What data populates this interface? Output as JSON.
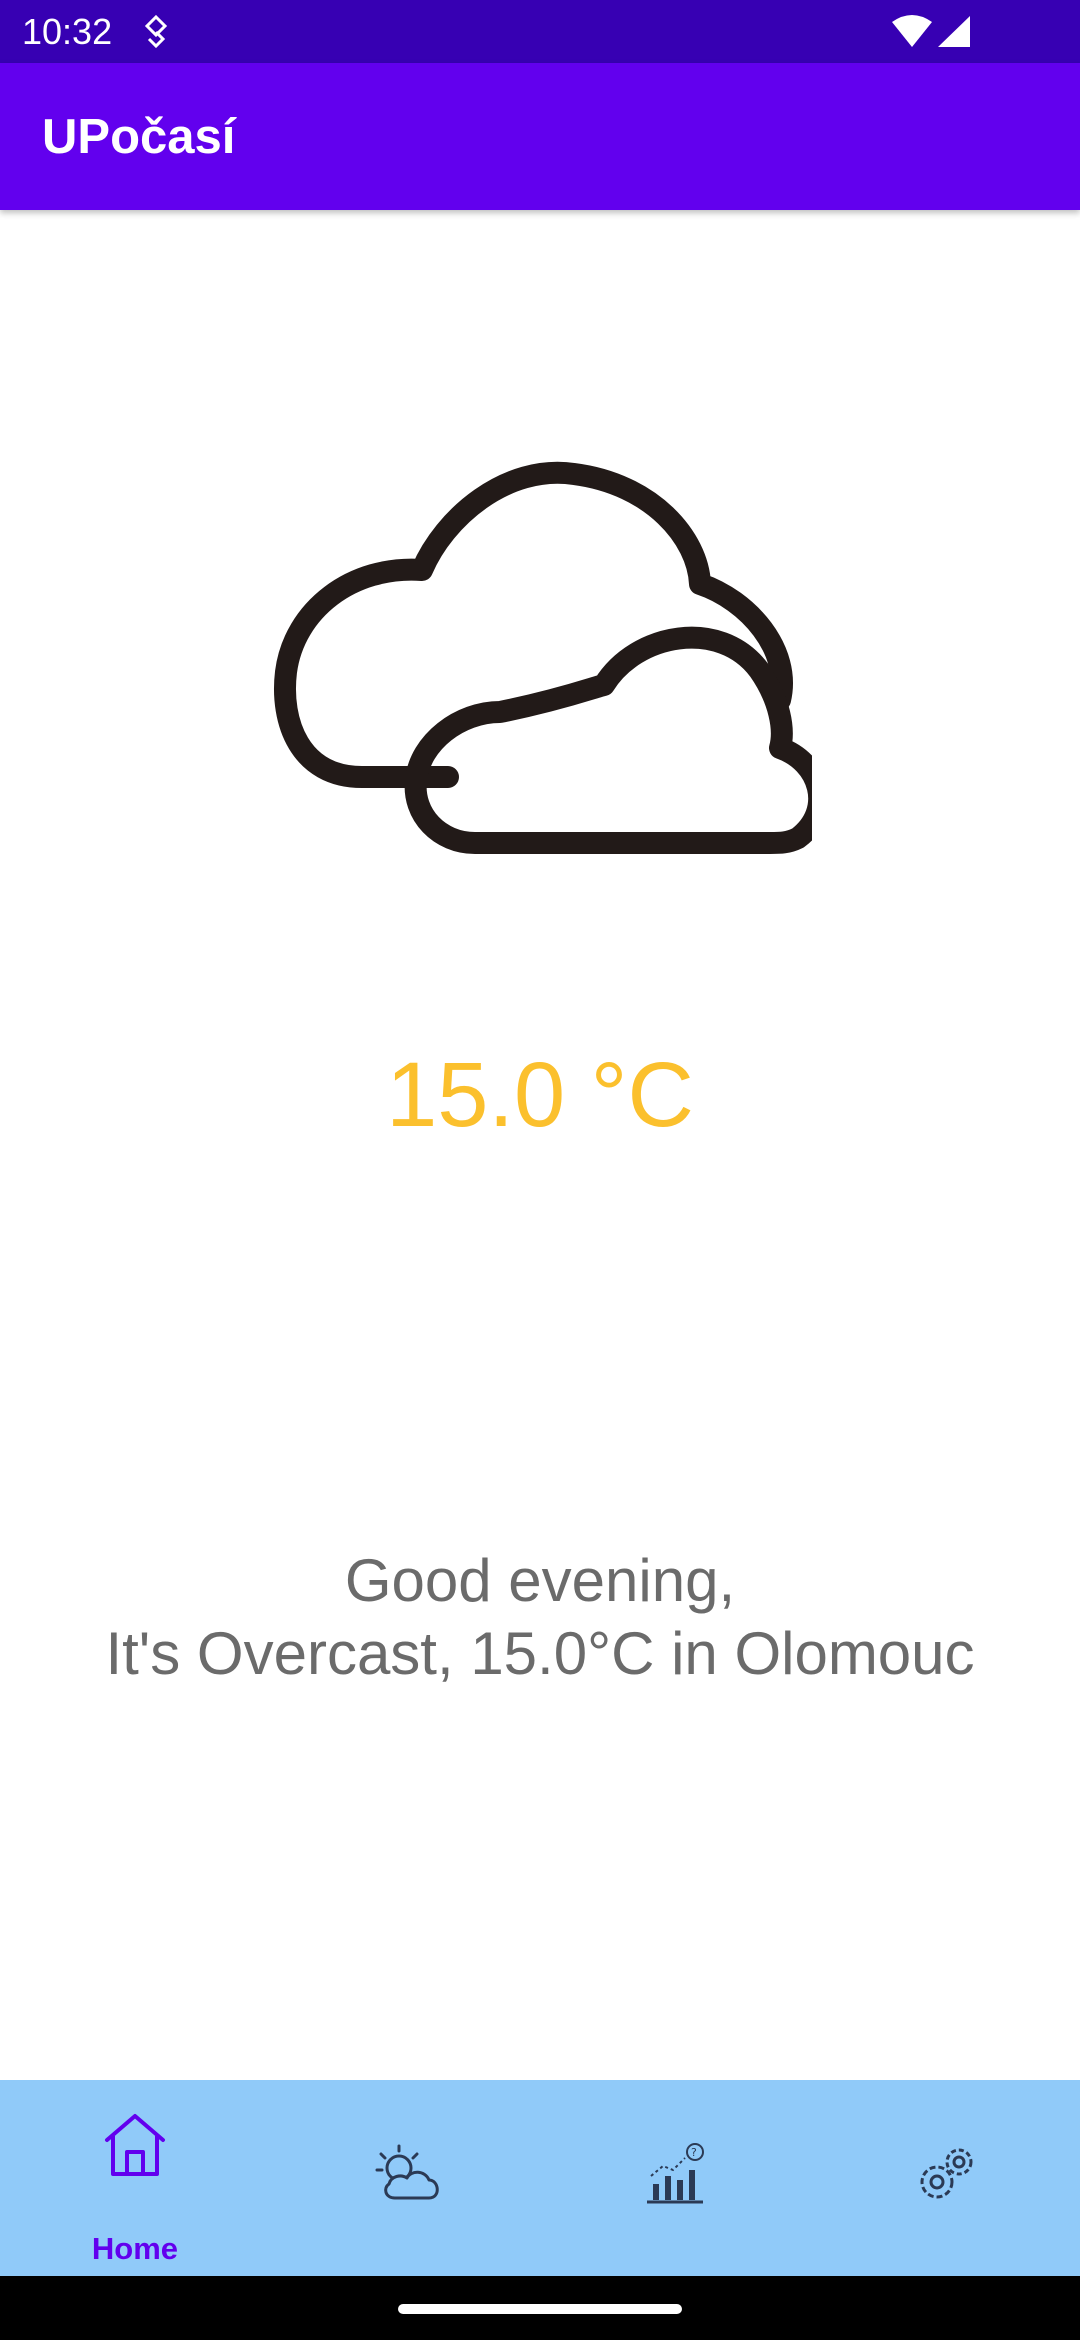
{
  "status_bar": {
    "time": "10:32",
    "icons": [
      "data-saver-icon",
      "wifi-icon",
      "cellular-signal-icon"
    ]
  },
  "app_bar": {
    "title": "UPočasí",
    "color": "#6200ee"
  },
  "weather": {
    "condition_icon": "cloudy-icon",
    "temperature": "15.0 °C",
    "temperature_color": "#fbc02d"
  },
  "greeting": {
    "line1": "Good evening,",
    "line2": "It's Overcast, 15.0°C in Olomouc"
  },
  "bottom_nav": {
    "background": "#90caf9",
    "items": [
      {
        "icon": "home-icon",
        "label": "Home",
        "selected": true
      },
      {
        "icon": "partly-cloudy-icon",
        "label": "",
        "selected": false
      },
      {
        "icon": "chart-icon",
        "label": "",
        "selected": false
      },
      {
        "icon": "settings-icon",
        "label": "",
        "selected": false
      }
    ]
  }
}
